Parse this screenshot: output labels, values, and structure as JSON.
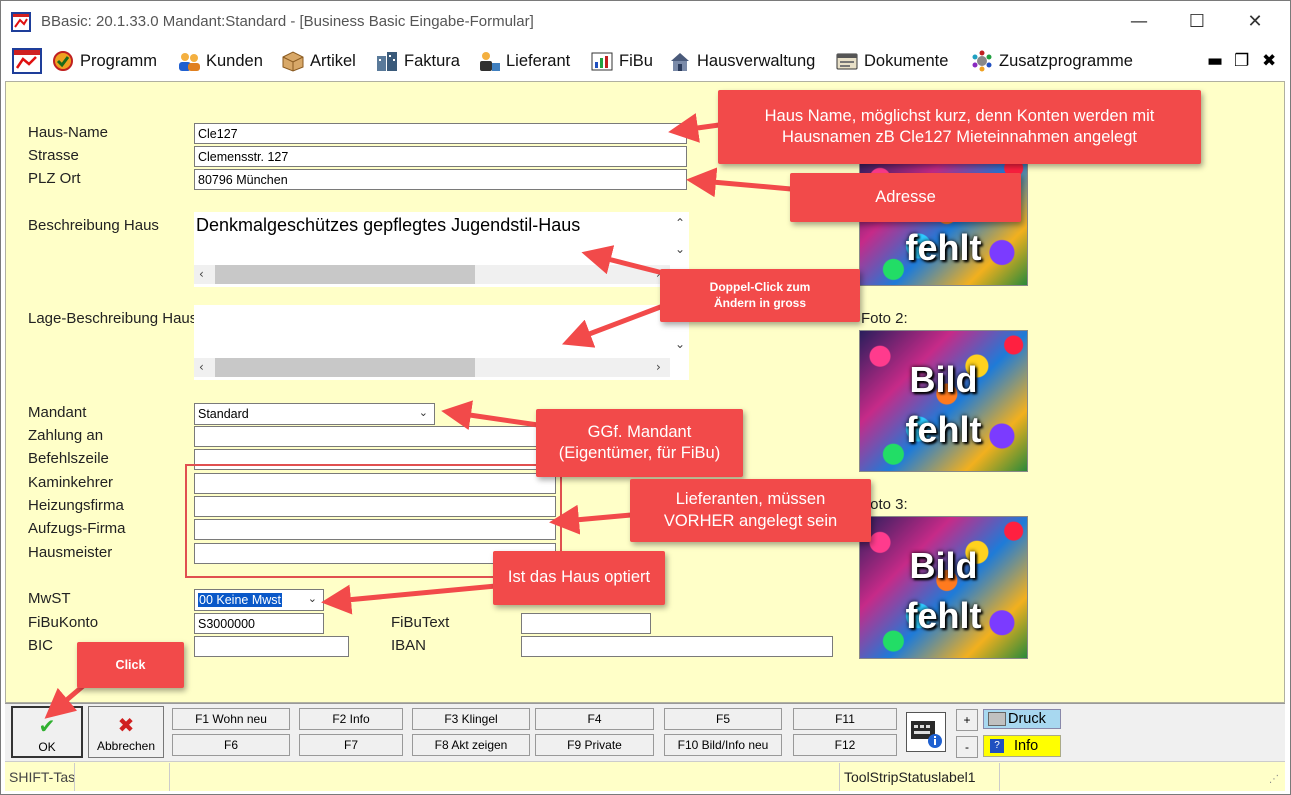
{
  "window": {
    "title": "BBasic: 20.1.33.0 Mandant:Standard  - [Business Basic Eingabe-Formular]",
    "minimize": "—",
    "maximize": "☐",
    "close": "✕"
  },
  "menu": {
    "items": [
      {
        "label": "Programm",
        "icon": "program-icon"
      },
      {
        "label": "Kunden",
        "icon": "customers-icon"
      },
      {
        "label": "Artikel",
        "icon": "article-box-icon"
      },
      {
        "label": "Faktura",
        "icon": "invoice-icon"
      },
      {
        "label": "Lieferant",
        "icon": "supplier-icon"
      },
      {
        "label": "FiBu",
        "icon": "accounting-icon"
      },
      {
        "label": "Hausverwaltung",
        "icon": "house-management-icon"
      },
      {
        "label": "Dokumente",
        "icon": "documents-icon"
      },
      {
        "label": "Zusatzprogramme",
        "icon": "addon-programs-icon"
      }
    ],
    "mdi_min": "▬",
    "mdi_restore": "❐",
    "mdi_close": "✖"
  },
  "form": {
    "labels": {
      "haus_name": "Haus-Name",
      "strasse": "Strasse",
      "plz_ort": "PLZ Ort",
      "beschreibung": "Beschreibung Haus",
      "lage": "Lage-Beschreibung Haus",
      "mandant": "Mandant",
      "zahlung": "Zahlung an",
      "befehlszeile": "Befehlszeile",
      "kaminkehrer": "Kaminkehrer",
      "heizungsfirma": "Heizungsfirma",
      "aufzugsfirma": "Aufzugs-Firma",
      "hausmeister": "Hausmeister",
      "mwst": "MwST",
      "fibukonto": "FiBuKonto",
      "fibutext": "FiBuText",
      "bic": "BIC",
      "iban": "IBAN"
    },
    "values": {
      "haus_name": "Cle127",
      "strasse": "Clemensstr. 127",
      "plz_ort": "80796 München",
      "beschreibung": "Denkmalgeschützes gepflegtes Jugendstil-Haus",
      "lage": "",
      "mandant": "Standard",
      "zahlung": "",
      "befehlszeile": "",
      "kaminkehrer": "",
      "heizungsfirma": "",
      "aufzugsfirma": "",
      "hausmeister": "",
      "mwst": "00 Keine Mwst",
      "fibukonto": "S3000000",
      "fibutext": "",
      "bic": "",
      "iban": ""
    },
    "photos": {
      "foto2_label": "Foto 2:",
      "foto3_label": "Foto 3:",
      "placeholder_line1": "Bild",
      "placeholder_line2": "fehlt"
    }
  },
  "callouts": {
    "haus_name": "Haus Name, möglichst kurz, denn Konten werden mit Hausnamen zB Cle127 Mieteinnahmen angelegt",
    "adresse": "Adresse",
    "doppelclick": "Doppel-Click zum Ändern in gross",
    "mandant": "GGf. Mandant (Eigentümer, für FiBu)",
    "lieferanten": "Lieferanten, müssen VORHER angelegt sein",
    "optiert": "Ist das Haus optiert",
    "click": "Click"
  },
  "toolbar": {
    "ok": "OK",
    "abbrechen": "Abbrechen",
    "f1": "F1 Wohn neu",
    "f2": "F2 Info",
    "f3": "F3 Klingel",
    "f4": "F4",
    "f5": "F5",
    "f11": "F11",
    "f6": "F6",
    "f7": "F7",
    "f8": "F8 Akt zeigen",
    "f9": "F9 Private",
    "f10": "F10 Bild/Info neu",
    "f12": "F12",
    "plus": "+",
    "minus": "-",
    "druck": "Druck",
    "info": "Info"
  },
  "status": {
    "cell1": "SHIFT-Tas",
    "cell2": "",
    "cell3": "",
    "cell4": "ToolStripStatuslabel1"
  },
  "colors": {
    "form_bg": "#ffffc8",
    "callout": "#f24a4a",
    "arrow": "#f24a4a",
    "info_bg": "#ffff00",
    "druck_bg": "#a8d8f0"
  }
}
